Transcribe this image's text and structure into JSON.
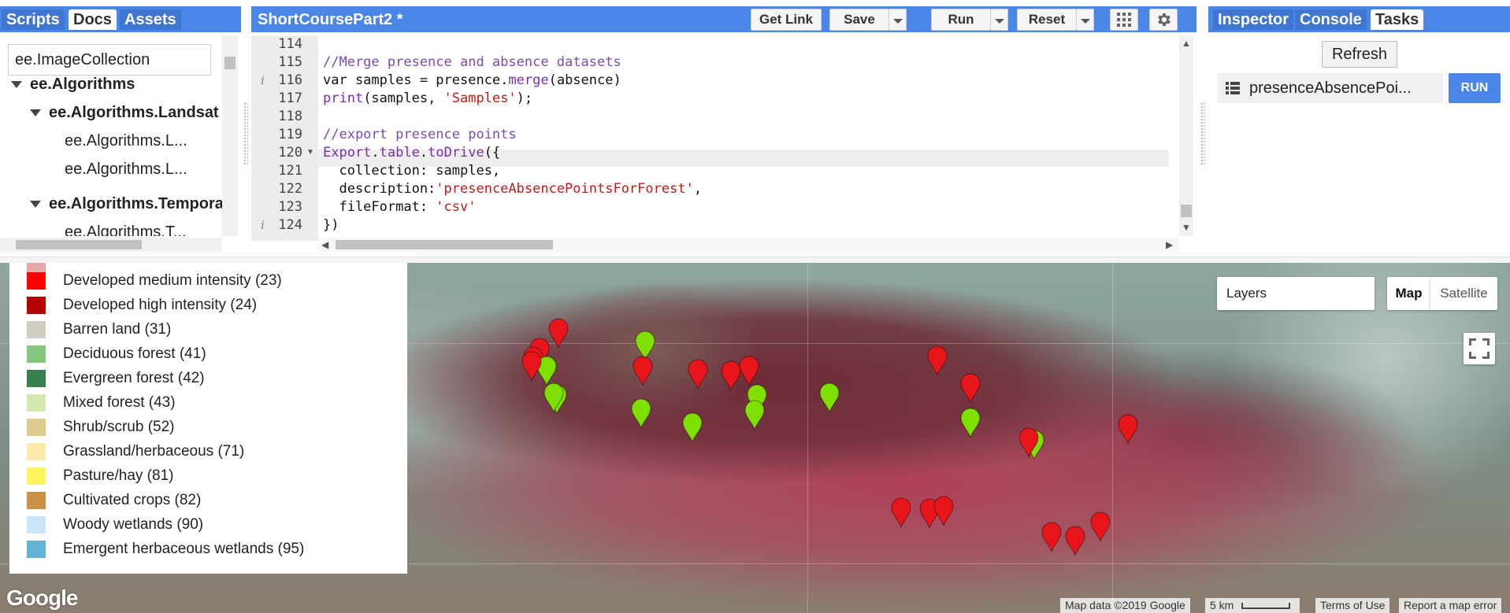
{
  "left_panel": {
    "tabs": [
      "Scripts",
      "Docs",
      "Assets"
    ],
    "active_tab": "Docs",
    "search_value": "ee.ImageCollection",
    "tree": [
      {
        "label": "ee.Algorithms",
        "level": 0,
        "bold": true,
        "expanded": true
      },
      {
        "label": "ee.Algorithms.Landsat",
        "level": 1,
        "bold": true,
        "expanded": true
      },
      {
        "label": "ee.Algorithms.L...",
        "level": 2,
        "bold": false
      },
      {
        "label": "ee.Algorithms.L...",
        "level": 2,
        "bold": false
      },
      {
        "label": "ee.Algorithms.Tempora",
        "level": 1,
        "bold": true,
        "expanded": true
      },
      {
        "label": "ee.Algorithms.T...",
        "level": 2,
        "bold": false
      }
    ]
  },
  "editor": {
    "title": "ShortCoursePart2 *",
    "buttons": {
      "get_link": "Get Link",
      "save": "Save",
      "run": "Run",
      "reset": "Reset"
    },
    "lines": [
      {
        "num": "114",
        "text": ""
      },
      {
        "num": "115",
        "text": "//Merge presence and absence datasets"
      },
      {
        "num": "116",
        "text": "var samples = presence.merge(absence)",
        "info": true
      },
      {
        "num": "117",
        "text": "print(samples, 'Samples');"
      },
      {
        "num": "118",
        "text": ""
      },
      {
        "num": "119",
        "text": "//export presence points"
      },
      {
        "num": "120",
        "text": "Export.table.toDrive({",
        "fold": true
      },
      {
        "num": "121",
        "text": "  collection: samples,"
      },
      {
        "num": "122",
        "text": "  description:'presenceAbsencePointsForForest',"
      },
      {
        "num": "123",
        "text": "  fileFormat: 'csv'"
      },
      {
        "num": "124",
        "text": "})",
        "info": true
      }
    ]
  },
  "right_panel": {
    "tabs": [
      "Inspector",
      "Console",
      "Tasks"
    ],
    "active_tab": "Tasks",
    "refresh_label": "Refresh",
    "task_name": "presenceAbsencePoi...",
    "run_label": "RUN"
  },
  "legend": [
    {
      "label": "Developed medium intensity (23)",
      "color": "#ff0000"
    },
    {
      "label": "Developed high intensity (24)",
      "color": "#b50000"
    },
    {
      "label": "Barren land (31)",
      "color": "#d2cdc0"
    },
    {
      "label": "Deciduous forest (41)",
      "color": "#85c77e"
    },
    {
      "label": "Evergreen forest (42)",
      "color": "#38814e"
    },
    {
      "label": "Mixed forest (43)",
      "color": "#d4e7b0"
    },
    {
      "label": "Shrub/scrub (52)",
      "color": "#dcca8f"
    },
    {
      "label": "Grassland/herbaceous (71)",
      "color": "#fde9aa"
    },
    {
      "label": "Pasture/hay (81)",
      "color": "#fbf65d"
    },
    {
      "label": "Cultivated crops (82)",
      "color": "#ca9146"
    },
    {
      "label": "Woody wetlands (90)",
      "color": "#c8e6f8"
    },
    {
      "label": "Emergent herbaceous wetlands (95)",
      "color": "#64b3d5"
    }
  ],
  "map": {
    "layers_label": "Layers",
    "map_types": [
      "Map",
      "Satellite"
    ],
    "active_map_type": "Map",
    "google_logo": "Google",
    "attribution": "Map data ©2019 Google",
    "scale_label": "5 km",
    "terms": "Terms of Use",
    "report": "Report a map error",
    "marker_colors": {
      "presence": "#7fe000",
      "absence": "#e8161b"
    }
  }
}
